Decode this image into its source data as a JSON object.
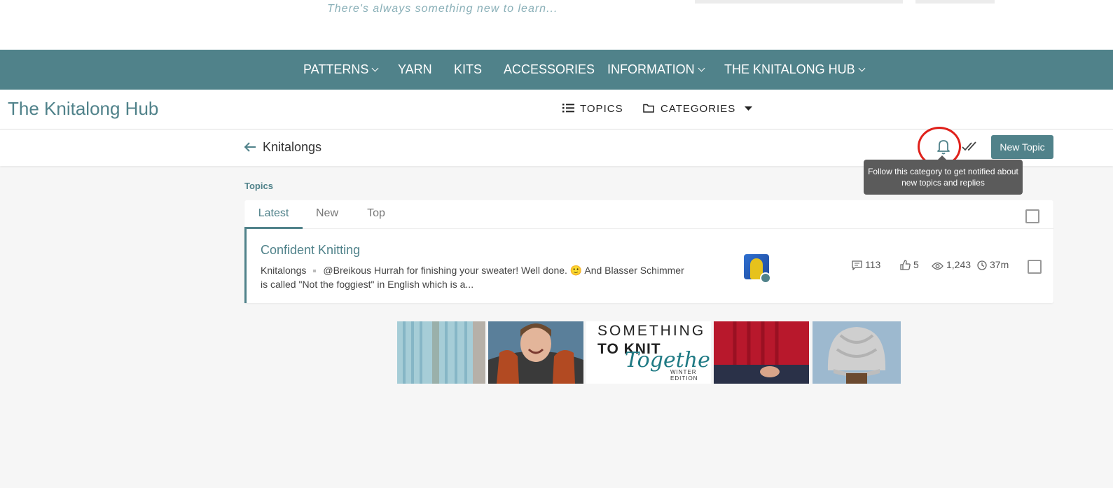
{
  "header": {
    "tagline": "There's always something new to learn..."
  },
  "main_nav": {
    "items": [
      {
        "label": "PATTERNS",
        "dropdown": true
      },
      {
        "label": "YARN",
        "dropdown": false
      },
      {
        "label": "KITS",
        "dropdown": false
      },
      {
        "label": "ACCESSORIES",
        "dropdown": false
      },
      {
        "label": "INFORMATION",
        "dropdown": true
      },
      {
        "label": "THE KNITALONG HUB",
        "dropdown": true
      }
    ]
  },
  "hub": {
    "title": "The Knitalong Hub",
    "topics_label": "TOPICS",
    "categories_label": "CATEGORIES"
  },
  "category": {
    "title": "Knitalongs",
    "new_topic_label": "New Topic",
    "tooltip": "Follow this category to get notified about new topics and replies"
  },
  "topics": {
    "section_label": "Topics",
    "tabs": [
      {
        "label": "Latest",
        "active": true
      },
      {
        "label": "New",
        "active": false
      },
      {
        "label": "Top",
        "active": false
      }
    ],
    "rows": [
      {
        "title": "Confident Knitting",
        "category": "Knitalongs",
        "excerpt_1": "@Breikous Hurrah for finishing your sweater! Well done. 🙂 And Blasser Schimmer",
        "excerpt_2": "is called \"Not the foggiest\" in English which is a...",
        "replies": "113",
        "likes": "5",
        "views": "1,243",
        "activity": "37m"
      }
    ]
  },
  "banner": {
    "line1": "SOMETHING",
    "line2": "TO KNIT",
    "script": "Together",
    "edition_1": "WINTER",
    "edition_2": "EDITION"
  },
  "colors": {
    "brand": "#50828a",
    "highlight": "#e0211b",
    "tooltip_bg": "#5b5b5b"
  }
}
